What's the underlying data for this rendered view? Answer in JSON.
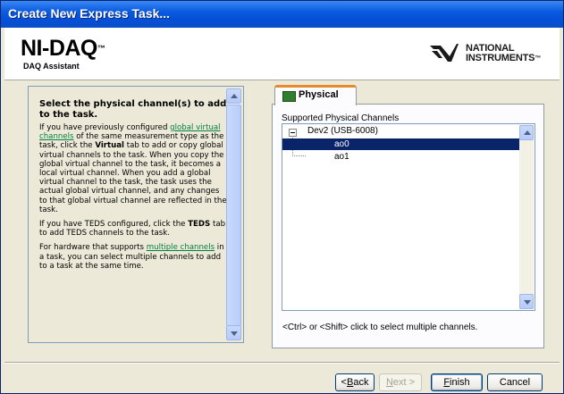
{
  "window": {
    "title": "Create New Express Task..."
  },
  "header": {
    "product_name": "NI-DAQ",
    "product_tm": "™",
    "product_subtitle": "DAQ Assistant",
    "vendor_line1": "NATIONAL",
    "vendor_line2": "INSTRUMENTS",
    "vendor_tm": "™"
  },
  "help": {
    "heading": "Select the physical channel(s) to add to the task.",
    "p1_a": "If you have previously configured ",
    "p1_link": "global virtual channels",
    "p1_b": " of the same measurement type as the task, click the ",
    "p1_bold": "Virtual",
    "p1_c": " tab to add or copy global virtual channels to the task. When you copy the global virtual channel to the task, it becomes a local virtual channel. When you add a global virtual channel to the task, the task uses the actual global virtual channel, and any changes to that global virtual channel are reflected in the task.",
    "p2_a": "If you have TEDS configured, click the ",
    "p2_bold": "TEDS",
    "p2_b": " tab to add TEDS channels to the task.",
    "p3_a": "For hardware that supports ",
    "p3_link": "multiple channels",
    "p3_b": " in a task, you can select multiple channels to add to a task at the same time."
  },
  "tabs": [
    {
      "label": "Physical",
      "icon": "channel-icon",
      "selected": true
    }
  ],
  "channels": {
    "label": "Supported Physical Channels",
    "device": "Dev2 (USB-6008)",
    "items": [
      {
        "label": "ao0",
        "selected": true
      },
      {
        "label": "ao1",
        "selected": false
      }
    ]
  },
  "hint": "<Ctrl> or <Shift> click to select multiple channels.",
  "buttons": {
    "back_pre": "<",
    "back_key": "B",
    "back_rest": "ack",
    "next_pre": "",
    "next_key": "N",
    "next_rest": "ext >",
    "finish_pre": "",
    "finish_key": "F",
    "finish_rest": "inish",
    "cancel": "Cancel"
  },
  "colors": {
    "title_bar": "#0a5be0",
    "selection": "#0a246a",
    "link": "#007f3f",
    "tab_accent": "#e68b2c"
  }
}
